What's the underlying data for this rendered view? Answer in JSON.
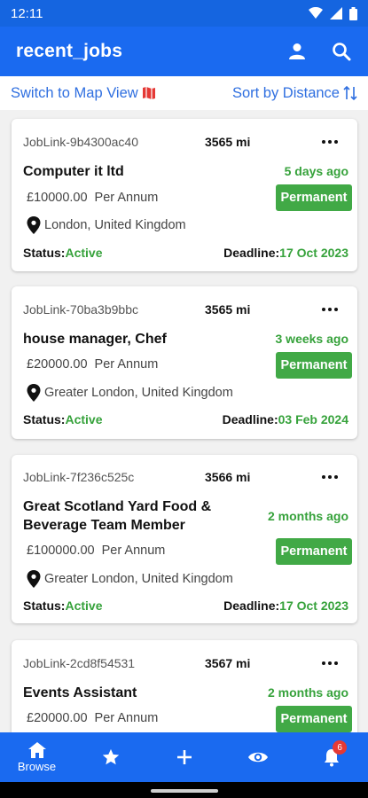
{
  "status_bar": {
    "time": "12:11"
  },
  "app_bar": {
    "title": "recent_jobs",
    "icons": [
      "person-icon",
      "search-icon"
    ]
  },
  "sub_bar": {
    "map_view": "Switch to Map View",
    "sort": "Sort by Distance"
  },
  "colors": {
    "primary": "#1a6af0",
    "green": "#36a23b",
    "badge_green": "#41a946",
    "link_blue": "#2f6fe0"
  },
  "jobs": [
    {
      "ref": "JobLink-9b4300ac40",
      "distance": "3565 mi",
      "title": "Computer it ltd",
      "posted": "5 days ago",
      "salary": "£10000.00",
      "period": "Per Annum",
      "type": "Permanent",
      "location": "London, United Kingdom",
      "status_label": "Status:",
      "status": "Active",
      "deadline_label": "Deadline:",
      "deadline": "17 Oct 2023"
    },
    {
      "ref": "JobLink-70ba3b9bbc",
      "distance": "3565 mi",
      "title": "house manager, Chef",
      "posted": "3 weeks ago",
      "salary": "£20000.00",
      "period": "Per Annum",
      "type": "Permanent",
      "location": "Greater London, United Kingdom",
      "status_label": "Status:",
      "status": "Active",
      "deadline_label": "Deadline:",
      "deadline": "03 Feb 2024"
    },
    {
      "ref": "JobLink-7f236c525c",
      "distance": "3566 mi",
      "title": "Great Scotland Yard Food & Beverage Team Member",
      "posted": "2 months ago",
      "salary": "£100000.00",
      "period": "Per Annum",
      "type": "Permanent",
      "location": "Greater London, United Kingdom",
      "status_label": "Status:",
      "status": "Active",
      "deadline_label": "Deadline:",
      "deadline": "17 Oct 2023"
    },
    {
      "ref": "JobLink-2cd8f54531",
      "distance": "3567 mi",
      "title": "Events Assistant",
      "posted": "2 months ago",
      "salary": "£20000.00",
      "period": "Per Annum",
      "type": "Permanent"
    }
  ],
  "bottom_nav": {
    "browse": "Browse",
    "notification_count": "6"
  }
}
